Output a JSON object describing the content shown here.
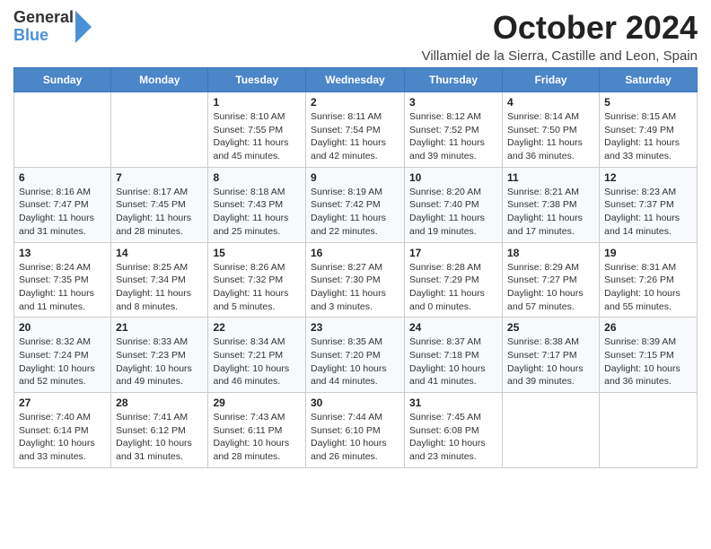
{
  "header": {
    "logo_general": "General",
    "logo_blue": "Blue",
    "month_title": "October 2024",
    "location": "Villamiel de la Sierra, Castille and Leon, Spain"
  },
  "calendar": {
    "days_of_week": [
      "Sunday",
      "Monday",
      "Tuesday",
      "Wednesday",
      "Thursday",
      "Friday",
      "Saturday"
    ],
    "weeks": [
      [
        {
          "day": "",
          "info": ""
        },
        {
          "day": "",
          "info": ""
        },
        {
          "day": "1",
          "info": "Sunrise: 8:10 AM\nSunset: 7:55 PM\nDaylight: 11 hours and 45 minutes."
        },
        {
          "day": "2",
          "info": "Sunrise: 8:11 AM\nSunset: 7:54 PM\nDaylight: 11 hours and 42 minutes."
        },
        {
          "day": "3",
          "info": "Sunrise: 8:12 AM\nSunset: 7:52 PM\nDaylight: 11 hours and 39 minutes."
        },
        {
          "day": "4",
          "info": "Sunrise: 8:14 AM\nSunset: 7:50 PM\nDaylight: 11 hours and 36 minutes."
        },
        {
          "day": "5",
          "info": "Sunrise: 8:15 AM\nSunset: 7:49 PM\nDaylight: 11 hours and 33 minutes."
        }
      ],
      [
        {
          "day": "6",
          "info": "Sunrise: 8:16 AM\nSunset: 7:47 PM\nDaylight: 11 hours and 31 minutes."
        },
        {
          "day": "7",
          "info": "Sunrise: 8:17 AM\nSunset: 7:45 PM\nDaylight: 11 hours and 28 minutes."
        },
        {
          "day": "8",
          "info": "Sunrise: 8:18 AM\nSunset: 7:43 PM\nDaylight: 11 hours and 25 minutes."
        },
        {
          "day": "9",
          "info": "Sunrise: 8:19 AM\nSunset: 7:42 PM\nDaylight: 11 hours and 22 minutes."
        },
        {
          "day": "10",
          "info": "Sunrise: 8:20 AM\nSunset: 7:40 PM\nDaylight: 11 hours and 19 minutes."
        },
        {
          "day": "11",
          "info": "Sunrise: 8:21 AM\nSunset: 7:38 PM\nDaylight: 11 hours and 17 minutes."
        },
        {
          "day": "12",
          "info": "Sunrise: 8:23 AM\nSunset: 7:37 PM\nDaylight: 11 hours and 14 minutes."
        }
      ],
      [
        {
          "day": "13",
          "info": "Sunrise: 8:24 AM\nSunset: 7:35 PM\nDaylight: 11 hours and 11 minutes."
        },
        {
          "day": "14",
          "info": "Sunrise: 8:25 AM\nSunset: 7:34 PM\nDaylight: 11 hours and 8 minutes."
        },
        {
          "day": "15",
          "info": "Sunrise: 8:26 AM\nSunset: 7:32 PM\nDaylight: 11 hours and 5 minutes."
        },
        {
          "day": "16",
          "info": "Sunrise: 8:27 AM\nSunset: 7:30 PM\nDaylight: 11 hours and 3 minutes."
        },
        {
          "day": "17",
          "info": "Sunrise: 8:28 AM\nSunset: 7:29 PM\nDaylight: 11 hours and 0 minutes."
        },
        {
          "day": "18",
          "info": "Sunrise: 8:29 AM\nSunset: 7:27 PM\nDaylight: 10 hours and 57 minutes."
        },
        {
          "day": "19",
          "info": "Sunrise: 8:31 AM\nSunset: 7:26 PM\nDaylight: 10 hours and 55 minutes."
        }
      ],
      [
        {
          "day": "20",
          "info": "Sunrise: 8:32 AM\nSunset: 7:24 PM\nDaylight: 10 hours and 52 minutes."
        },
        {
          "day": "21",
          "info": "Sunrise: 8:33 AM\nSunset: 7:23 PM\nDaylight: 10 hours and 49 minutes."
        },
        {
          "day": "22",
          "info": "Sunrise: 8:34 AM\nSunset: 7:21 PM\nDaylight: 10 hours and 46 minutes."
        },
        {
          "day": "23",
          "info": "Sunrise: 8:35 AM\nSunset: 7:20 PM\nDaylight: 10 hours and 44 minutes."
        },
        {
          "day": "24",
          "info": "Sunrise: 8:37 AM\nSunset: 7:18 PM\nDaylight: 10 hours and 41 minutes."
        },
        {
          "day": "25",
          "info": "Sunrise: 8:38 AM\nSunset: 7:17 PM\nDaylight: 10 hours and 39 minutes."
        },
        {
          "day": "26",
          "info": "Sunrise: 8:39 AM\nSunset: 7:15 PM\nDaylight: 10 hours and 36 minutes."
        }
      ],
      [
        {
          "day": "27",
          "info": "Sunrise: 7:40 AM\nSunset: 6:14 PM\nDaylight: 10 hours and 33 minutes."
        },
        {
          "day": "28",
          "info": "Sunrise: 7:41 AM\nSunset: 6:12 PM\nDaylight: 10 hours and 31 minutes."
        },
        {
          "day": "29",
          "info": "Sunrise: 7:43 AM\nSunset: 6:11 PM\nDaylight: 10 hours and 28 minutes."
        },
        {
          "day": "30",
          "info": "Sunrise: 7:44 AM\nSunset: 6:10 PM\nDaylight: 10 hours and 26 minutes."
        },
        {
          "day": "31",
          "info": "Sunrise: 7:45 AM\nSunset: 6:08 PM\nDaylight: 10 hours and 23 minutes."
        },
        {
          "day": "",
          "info": ""
        },
        {
          "day": "",
          "info": ""
        }
      ]
    ]
  }
}
